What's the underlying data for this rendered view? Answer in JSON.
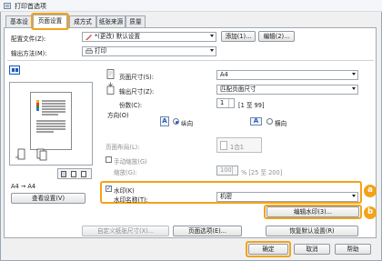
{
  "window": {
    "title": "打印首选项"
  },
  "tabs": [
    {
      "label": "基本设",
      "active": false
    },
    {
      "label": "页面设置",
      "active": true
    },
    {
      "label": "成方式",
      "active": false
    },
    {
      "label": "纸张来源",
      "active": false
    },
    {
      "label": "质量",
      "active": false
    }
  ],
  "profile": {
    "label": "配置文件(Z):",
    "value": "*(更改) 默认设置",
    "add_label": "添加(1)...",
    "edit_label": "编辑(2)..."
  },
  "output": {
    "label": "输出方法(M):",
    "value": "打印"
  },
  "preview": {
    "page_label": "A4 → A4",
    "view_settings_label": "查看设置(V)"
  },
  "page_size": {
    "label": "页面尺寸(S):",
    "value": "A4"
  },
  "output_size": {
    "label": "输出尺寸(Z):",
    "value": "匹配页面尺寸"
  },
  "copies": {
    "label": "份数(C):",
    "value": "1",
    "range": "[1 至 99]"
  },
  "orientation": {
    "label": "方向(O)",
    "portrait_label": "纵向",
    "landscape_label": "横向",
    "selected": "portrait",
    "portrait_glyph": "A",
    "landscape_glyph": "A"
  },
  "page_layout": {
    "label": "页面布局(L):",
    "value": "1合1"
  },
  "manual_scaling": {
    "label": "手动缩放(G)",
    "checked": false
  },
  "scaling": {
    "label": "缩放(G):",
    "value": "100",
    "range": "% [25 至 200]"
  },
  "watermark": {
    "checkbox_label": "水印(K)",
    "checked": true,
    "name_label": "水印名称(T):",
    "name_value": "机密",
    "edit_label": "编辑水印(3)..."
  },
  "bottom_buttons": {
    "custom_size": "自定义纸张尺寸(X)...",
    "page_options": "页面选项(E)...",
    "restore_defaults": "恢复默认设置(R)",
    "ok": "确定",
    "cancel": "取消",
    "help": "帮助"
  },
  "callouts": {
    "a": "a",
    "b": "b"
  },
  "colors": {
    "highlight": "#f2a318",
    "accent": "#1e5bbf"
  }
}
